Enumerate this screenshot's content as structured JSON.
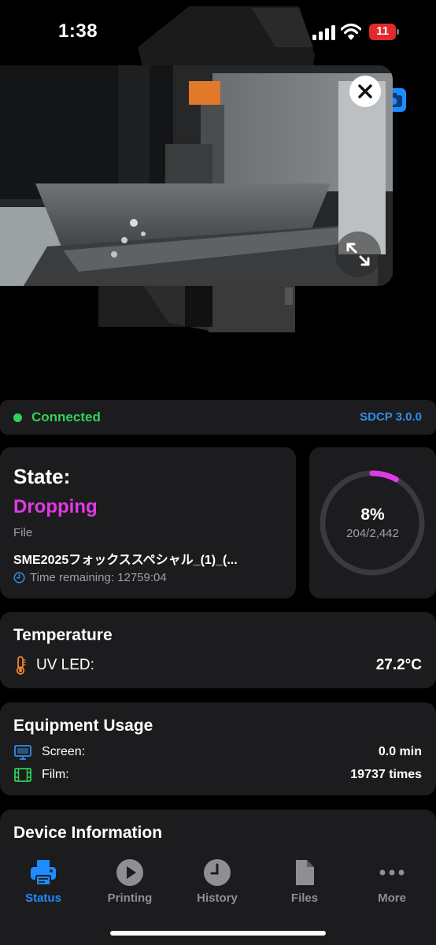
{
  "status_bar": {
    "time": "1:38",
    "battery_level": "11"
  },
  "camera": {
    "close_icon": "close-icon",
    "expand_icon": "expand-icon",
    "snapshot_icon": "camera-icon"
  },
  "connection": {
    "status": "Connected",
    "protocol": "SDCP 3.0.0",
    "status_color": "#31d158"
  },
  "state": {
    "label": "State:",
    "value": "Dropping",
    "value_color": "#e03ae8",
    "file_label": "File",
    "file_name": "SME2025フォックススペシャル_(1)_(...",
    "time_remaining": "Time remaining: 12759:04"
  },
  "progress": {
    "percent_text": "8%",
    "percent": 8,
    "layers": "204/2,442",
    "arc_color": "#e03ae8"
  },
  "temperature": {
    "title": "Temperature",
    "uv_label": "UV LED:",
    "uv_value": "27.2°C"
  },
  "equipment": {
    "title": "Equipment Usage",
    "screen_label": "Screen:",
    "screen_value": "0.0 min",
    "film_label": "Film:",
    "film_value": "19737 times"
  },
  "device": {
    "title": "Device Information"
  },
  "tabs": [
    {
      "label": "Status",
      "icon": "printer-icon",
      "active": true
    },
    {
      "label": "Printing",
      "icon": "play-icon",
      "active": false
    },
    {
      "label": "History",
      "icon": "clock-icon",
      "active": false
    },
    {
      "label": "Files",
      "icon": "document-icon",
      "active": false
    },
    {
      "label": "More",
      "icon": "ellipsis-icon",
      "active": false
    }
  ],
  "colors": {
    "accent": "#1d8cff",
    "card": "#1c1c1e",
    "muted": "#a0a0a4"
  }
}
